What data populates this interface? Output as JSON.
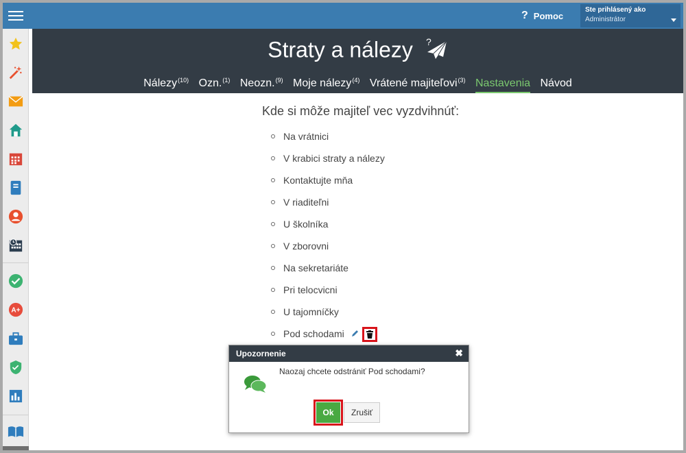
{
  "topbar": {
    "help_label": "Pomoc",
    "user_line1": "Ste prihlásený ako",
    "user_line2": "Administrátor"
  },
  "header": {
    "title": "Straty a nálezy",
    "tabs": [
      {
        "label": "Nálezy",
        "count": "(10)"
      },
      {
        "label": "Ozn.",
        "count": "(1)"
      },
      {
        "label": "Neozn.",
        "count": "(9)"
      },
      {
        "label": "Moje nálezy",
        "count": "(4)"
      },
      {
        "label": "Vrátené majiteľovi",
        "count": "(3)"
      },
      {
        "label": "Nastavenia",
        "count": ""
      },
      {
        "label": "Návod",
        "count": ""
      }
    ],
    "active_tab": "Nastavenia"
  },
  "content": {
    "question": "Kde si môže majiteľ vec vyzdvihnúť:",
    "places": [
      "Na vrátnici",
      "V krabici straty a nálezy",
      "Kontaktujte mňa",
      "V riaditeľni",
      "U školníka",
      "V zborovni",
      "Na sekretariáte",
      "Pri telocvicni",
      "U tajomníčky",
      "Pod schodami"
    ]
  },
  "modal": {
    "title": "Upozornenie",
    "message": "Naozaj chcete odstrániť Pod schodami?",
    "ok_label": "Ok",
    "cancel_label": "Zrušiť"
  },
  "sidebar": {
    "icons": [
      "star-icon",
      "magic-wand-icon",
      "mail-icon",
      "home-icon",
      "calendar-icon",
      "notebook-icon",
      "user-icon",
      "schedule-icon",
      "check-icon",
      "grade-icon",
      "briefcase-icon",
      "shield-icon",
      "chart-icon",
      "book-icon"
    ]
  },
  "colors": {
    "topbar": "#3b7cb0",
    "header": "#333c45",
    "active_tab": "#7bc96f",
    "ok_button": "#49a942",
    "highlight": "#d8131a"
  }
}
